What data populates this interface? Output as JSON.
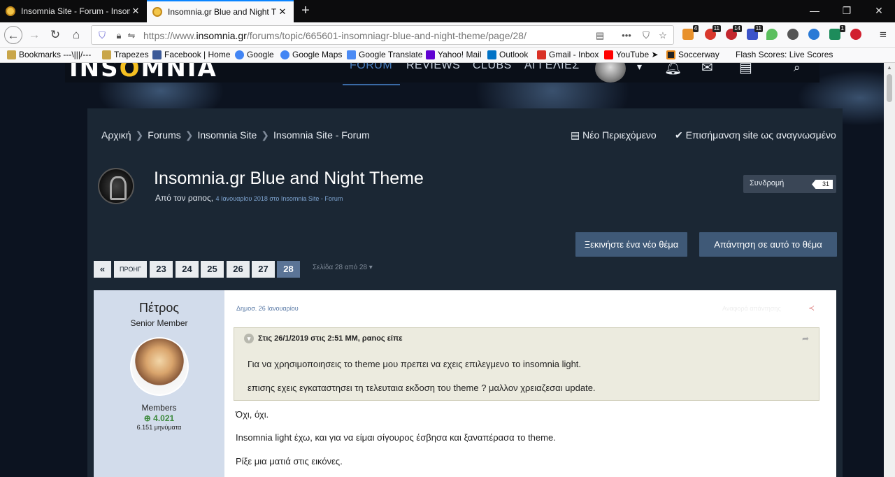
{
  "browser": {
    "tabs": [
      {
        "title": "Insomnia Site - Forum - Insom",
        "active": false
      },
      {
        "title": "Insomnia.gr Blue and Night Th",
        "active": true
      }
    ],
    "new_tab": "+",
    "window": {
      "min": "—",
      "max": "❐",
      "close": "✕"
    },
    "url": {
      "prefix": "https://www.",
      "domain": "insomnia.gr",
      "path": "/forums/topic/665601-insomniagr-blue-and-night-theme/page/28/"
    },
    "extensions": [
      {
        "icon": "ext-bell-icon",
        "badge": "4",
        "color": "#e8912c"
      },
      {
        "icon": "ext-feedly-icon",
        "badge": "11",
        "color": "#d9382c"
      },
      {
        "icon": "ext-adblock-icon",
        "badge": "14",
        "color": "#c3272e"
      },
      {
        "icon": "ext-puzzle-icon",
        "badge": "11",
        "color": "#3b53c9"
      },
      {
        "icon": "ext-heart-icon",
        "badge": "",
        "color": "#5bbf5e"
      },
      {
        "icon": "ext-eye-icon",
        "badge": "",
        "color": "#555555"
      },
      {
        "icon": "ext-euro-icon",
        "badge": "",
        "color": "#2a7ad6"
      },
      {
        "icon": "ext-s-icon",
        "badge": "1",
        "color": "#1d8c5b"
      },
      {
        "icon": "ext-record-icon",
        "badge": "",
        "color": "#d1202f"
      }
    ],
    "bookmarks": [
      {
        "label": "Bookmarks ---\\|||/---",
        "icon": "folder-icon"
      },
      {
        "label": "Trapezes",
        "icon": "folder-icon"
      },
      {
        "label": "Facebook | Home",
        "icon": "facebook-icon"
      },
      {
        "label": "Google",
        "icon": "google-icon"
      },
      {
        "label": "Google Maps",
        "icon": "google-icon"
      },
      {
        "label": "Google Translate",
        "icon": "translate-icon"
      },
      {
        "label": "Yahoo! Mail",
        "icon": "yahoo-icon"
      },
      {
        "label": "Outlook",
        "icon": "outlook-icon"
      },
      {
        "label": "Gmail - Inbox",
        "icon": "gmail-icon"
      },
      {
        "label": "YouTube ➤",
        "icon": "youtube-icon"
      },
      {
        "label": "Soccerway",
        "icon": "soccerway-icon"
      },
      {
        "label": "Flash Scores: Live Scores",
        "icon": ""
      }
    ]
  },
  "site": {
    "logo_left": "INS",
    "logo_o": "O",
    "logo_right": "MNIA",
    "nav": [
      "FORUM",
      "REVIEWS",
      "CLUBS",
      "ΑΓΓΕΛΙΕΣ"
    ],
    "user_menu_caret": "▾"
  },
  "breadcrumbs": [
    "Αρχική",
    "Forums",
    "Insomnia Site",
    "Insomnia Site - Forum"
  ],
  "actions": {
    "new_content": "Νέο Περιεχόμενο",
    "mark_read": "Επισήμανση site ως αναγνωσμένο"
  },
  "thread": {
    "title": "Insomnia.gr Blue and Night Theme",
    "by": "Από τον ραnoς,",
    "meta_small": "4 Ιανουαρίου 2018 στο Insomnia Site - Forum",
    "follow_label": "Συνδρομή",
    "follow_count": "31"
  },
  "buttons": {
    "new_topic": "Ξεκινήστε ένα νέο θέμα",
    "reply": "Απάντηση σε αυτό το θέμα"
  },
  "pagination": {
    "first": "«",
    "prev": "ΠΡΟΗΓ",
    "pages": [
      "23",
      "24",
      "25",
      "26",
      "27",
      "28"
    ],
    "current": "28",
    "label": "Σελίδα 28 από 28 ▾"
  },
  "post": {
    "author": {
      "name": "Πέτρος",
      "rank": "Senior Member",
      "group": "Members",
      "reputation": "⊕ 4.021",
      "posts": "6.151 μηνύματα"
    },
    "date": "Δημοσ. 26 Ιανουαρίου",
    "report": "Αναφορά απάντησης",
    "quote": {
      "header": "Στις 26/1/2019 στις 2:51 ΜΜ, ραnoς είπε",
      "lines": [
        "Για να χρησιμοποιησεις το theme μου πρεπει να εχεις επιλεγμενο το insomnia light.",
        "επισης εχεις εγκαταστησει τη τελευταια εκδοση του theme ? μαλλον χρειαζεσαι update."
      ]
    },
    "body": [
      "Όχι, όχι.",
      "Insomnia light έχω, και για να είμαι σίγουρος έσβησα και ξαναπέρασα το theme.",
      "Ρίξε μια ματιά στις εικόνες."
    ]
  }
}
